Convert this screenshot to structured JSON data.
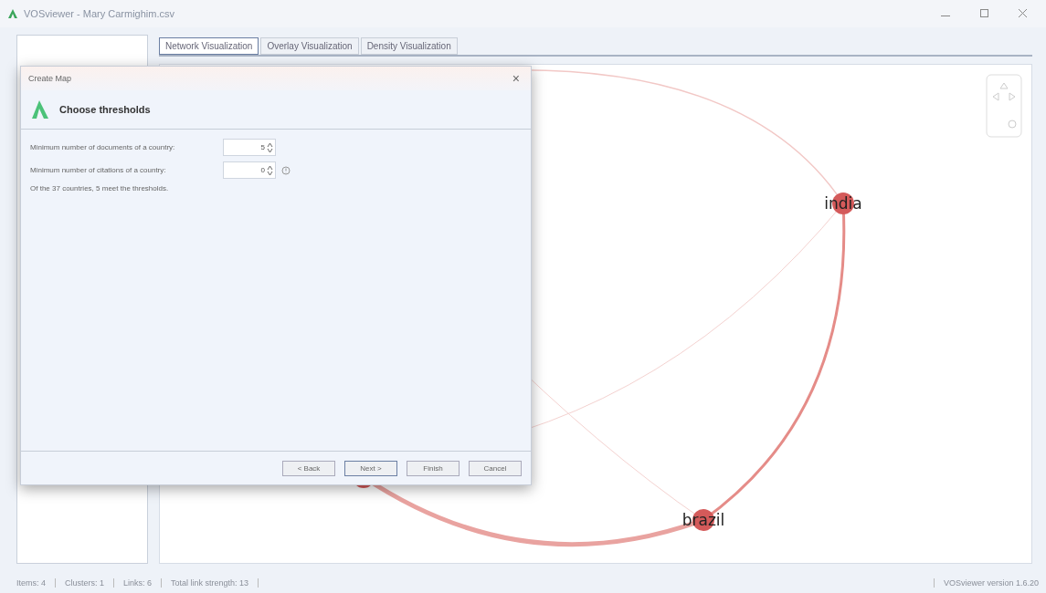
{
  "window": {
    "title": "VOSviewer - Mary Carmighim.csv"
  },
  "tabs": [
    {
      "label": "Network Visualization",
      "selected": true
    },
    {
      "label": "Overlay Visualization",
      "selected": false
    },
    {
      "label": "Density Visualization",
      "selected": false
    }
  ],
  "network": {
    "nodes": [
      {
        "label": "india"
      },
      {
        "label": "brazil"
      }
    ]
  },
  "dialog": {
    "title": "Create Map",
    "close": "×",
    "heading": "Choose thresholds",
    "fields": [
      {
        "label": "Minimum number of documents of a country:",
        "value": "5",
        "hint": false
      },
      {
        "label": "Minimum number of citations of a country:",
        "value": "0",
        "hint": true
      }
    ],
    "summary": "Of the 37 countries, 5 meet the thresholds.",
    "buttons": [
      {
        "label": "< Back",
        "selected": false
      },
      {
        "label": "Next >",
        "selected": true
      },
      {
        "label": "Finish",
        "selected": false
      },
      {
        "label": "Cancel",
        "selected": false
      }
    ]
  },
  "status_bar": {
    "items": [
      "Items: 4",
      "Clusters: 1",
      "Links: 6",
      "Total link strength: 13"
    ],
    "version": "VOSviewer version 1.6.20"
  }
}
